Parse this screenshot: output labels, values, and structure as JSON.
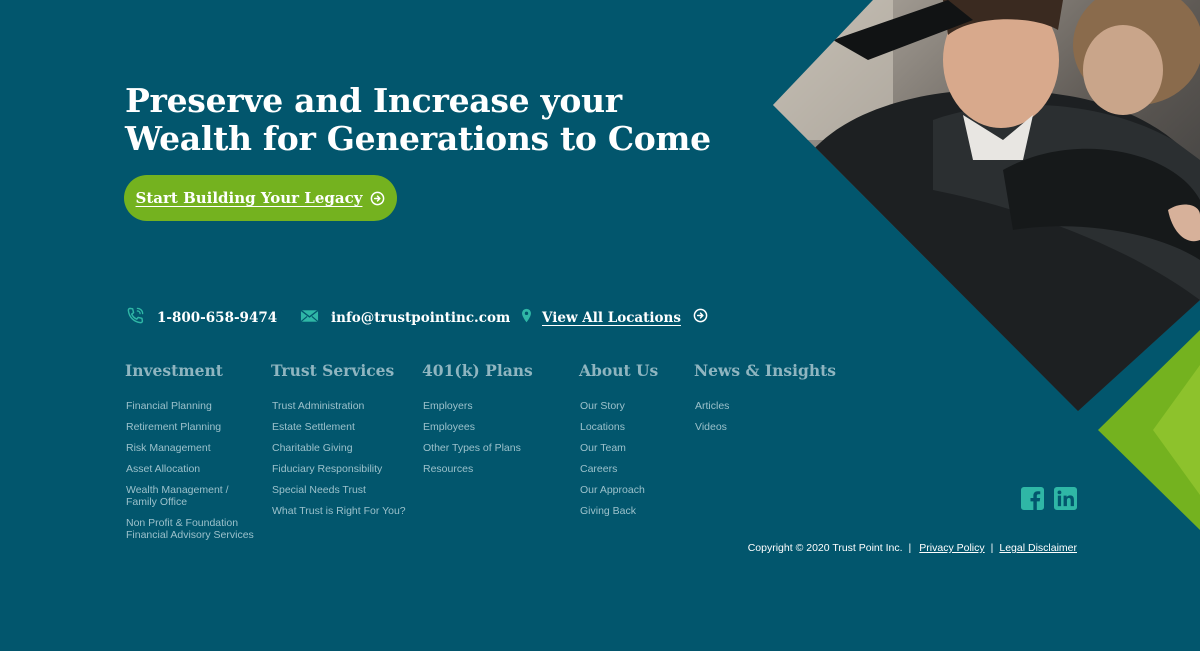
{
  "hero": {
    "title_line1": "Preserve and Increase your",
    "title_line2": "Wealth for Generations to Come",
    "cta_label": "Start Building Your Legacy"
  },
  "contact": {
    "phone": "1-800-658-9474",
    "email": "info@trustpointinc.com",
    "locations_label": "View All Locations"
  },
  "footer_columns": [
    {
      "heading": "Investment",
      "links": [
        "Financial Planning",
        "Retirement Planning",
        "Risk Management",
        "Asset Allocation",
        "Wealth Management / Family Office",
        "Non Profit & Foundation Financial Advisory Services"
      ]
    },
    {
      "heading": "Trust Services",
      "links": [
        "Trust Administration",
        "Estate Settlement",
        "Charitable Giving",
        "Fiduciary Responsibility",
        "Special Needs Trust",
        "What Trust is Right For You?"
      ]
    },
    {
      "heading": "401(k) Plans",
      "links": [
        "Employers",
        "Employees",
        "Other Types of Plans",
        "Resources"
      ]
    },
    {
      "heading": "About Us",
      "links": [
        "Our Story",
        "Locations",
        "Our Team",
        "Careers",
        "Our Approach",
        "Giving Back"
      ]
    },
    {
      "heading": "News & Insights",
      "links": [
        "Articles",
        "Videos"
      ]
    }
  ],
  "social": {
    "facebook_icon": "facebook-icon",
    "linkedin_icon": "linkedin-icon"
  },
  "legal": {
    "copyright": "Copyright © 2020 Trust Point Inc.",
    "separator": "|",
    "privacy": "Privacy Policy",
    "disclaimer": "Legal Disclaimer"
  },
  "colors": {
    "background": "#02566d",
    "accent_green": "#74b21f",
    "icon_teal": "#2fb7a6",
    "link_muted": "#9cc1cb",
    "heading_muted": "#8fb5c0"
  }
}
